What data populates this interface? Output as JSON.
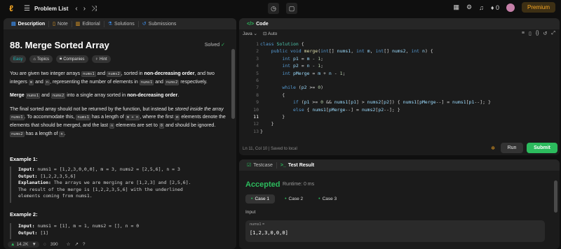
{
  "topbar": {
    "title": "Problem List",
    "premium": "Premium",
    "streak": "0"
  },
  "left_tabs": [
    {
      "label": "Description",
      "icon": "description-icon"
    },
    {
      "label": "Note",
      "icon": "note-icon"
    },
    {
      "label": "Editorial",
      "icon": "editorial-icon"
    },
    {
      "label": "Solutions",
      "icon": "solutions-icon"
    },
    {
      "label": "Submissions",
      "icon": "submissions-icon"
    }
  ],
  "problem": {
    "title": "88. Merge Sorted Array",
    "status": "Solved",
    "chips": [
      "Easy",
      "Topics",
      "Companies",
      "Hint"
    ],
    "p1_a": "You are given two integer arrays ",
    "p1_b": " and ",
    "p1_c": ", sorted in ",
    "p1_bold": "non-decreasing order",
    "p1_d": ", and two integers ",
    "p1_e": " and ",
    "p1_f": ", representing the number of elements in ",
    "p1_g": " and ",
    "p1_h": " respectively.",
    "p2_a": "Merge",
    "p2_b": " and ",
    "p2_c": " into a single array sorted in ",
    "p2_bold": "non-decreasing order",
    "p2_d": ".",
    "p3_a": "The final sorted array should not be returned by the function, but instead be ",
    "p3_it": "stored inside the array",
    "p3_b": ". To accommodate this, ",
    "p3_c": " has a length of ",
    "p3_d": ", where the first ",
    "p3_e": " elements denote the elements that should be merged, and the last ",
    "p3_f": " elements are set to ",
    "p3_g": " and should be ignored. ",
    "p3_h": " has a length of ",
    "p3_i": ".",
    "codes": {
      "nums1": "nums1",
      "nums2": "nums2",
      "m": "m",
      "n": "n",
      "mn": "m + n",
      "zero": "0"
    },
    "example1_title": "Example 1:",
    "ex1_input_lbl": "Input:",
    "ex1_input": " nums1 = [1,2,3,0,0,0], m = 3, nums2 = [2,5,6], n = 3",
    "ex1_output_lbl": "Output:",
    "ex1_output": " [1,2,2,3,5,6]",
    "ex1_expl_lbl": "Explanation:",
    "ex1_expl": " The arrays we are merging are [1,2,3] and [2,5,6].",
    "ex1_expl2": "The result of the merge is [1,2,2,3,5,6] with the underlined",
    "ex1_expl3": "elements coming from nums1.",
    "example2_title": "Example 2:",
    "ex2_input_lbl": "Input:",
    "ex2_input": " nums1 = [1], m = 1, nums2 = [], n = 0",
    "ex2_output_lbl": "Output:",
    "ex2_output": " [1]"
  },
  "left_footer": {
    "likes": "14.2K",
    "comments": "390"
  },
  "code_panel": {
    "tab": "Code",
    "language": "Java",
    "mode": "Auto",
    "line_numbers": [
      "1",
      "2",
      "3",
      "4",
      "5",
      "6",
      "7",
      "8",
      "9",
      "10",
      "11",
      "12",
      "13"
    ],
    "status": "Ln 11, Col 10",
    "saved": "Saved to local",
    "run": "Run",
    "submit": "Submit"
  },
  "test_panel": {
    "tab1": "Testcase",
    "tab2": "Test Result",
    "result": "Accepted",
    "runtime": "Runtime: 0 ms",
    "cases": [
      "Case 1",
      "Case 2",
      "Case 3"
    ],
    "input_label": "Input",
    "var_name": "nums1 =",
    "var_value": "[1,2,3,0,0,0]"
  }
}
